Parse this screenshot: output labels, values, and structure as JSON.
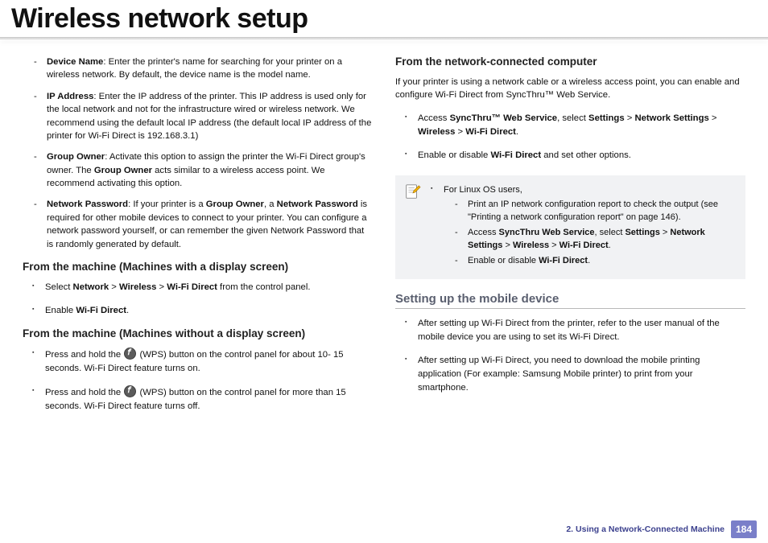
{
  "title": "Wireless network setup",
  "left": {
    "defs": [
      {
        "term": "Device Name",
        "body": ": Enter the printer's name for searching for your printer on a wireless network. By default, the device name is the model name."
      },
      {
        "term": "IP Address",
        "body": ": Enter the IP address of the printer. This IP address is used only for the local network and not for the infrastructure wired or wireless network. We recommend using the default local IP address (the default local IP address of the printer for Wi-Fi Direct is 192.168.3.1)"
      },
      {
        "term": "Group Owner",
        "body_pre": ": Activate this option to assign the printer the Wi-Fi Direct group's owner. The ",
        "body_bold": "Group Owner",
        "body_post": " acts similar to a wireless access point. We recommend activating this option."
      },
      {
        "term": "Network Password",
        "body_pre": ": If your printer is a ",
        "b1": "Group Owner",
        "mid": ", a ",
        "b2": "Network Password",
        "body_post": " is required for other mobile devices to connect to your printer. You can configure a network password yourself, or can remember the given Network Password that is randomly generated by default."
      }
    ],
    "h_display": "From the machine (Machines with a display screen)",
    "display_items": {
      "select_pre": "Select ",
      "p1": "Network",
      "p2": "Wireless",
      "p3": "Wi-Fi Direct",
      "select_post": " from the control panel.",
      "enable_pre": "Enable ",
      "enable_bold": "Wi-Fi Direct",
      "enable_post": "."
    },
    "h_nodisplay": "From the machine (Machines without a display screen)",
    "nodisplay": {
      "press_pre": "Press and hold the ",
      "wps_label": " (WPS) button on the control panel for about 10- 15 seconds. Wi-Fi Direct feature turns on.",
      "press2_post": " (WPS) button on the control panel for more than 15 seconds. Wi-Fi Direct feature turns off."
    }
  },
  "right": {
    "h_net": "From the network-connected computer",
    "net_intro": "If your printer is using a network cable or a wireless access point, you can enable and configure Wi-Fi Direct from SyncThru™ Web Service.",
    "net_items": {
      "access_pre": "Access ",
      "access_b": "SyncThru™ Web Service",
      "sel": ", select ",
      "s1": "Settings",
      "s2": "Network Settings",
      "s3": "Wireless",
      "s4": "Wi-Fi Direct",
      "enable_pre": "Enable or disable ",
      "enable_b": "Wi-Fi Direct",
      "enable_post": " and set other options."
    },
    "note": {
      "linux": "For Linux OS users,",
      "n1_pre": "Print an IP network configuration report to check the output (see \"Printing a network configuration report\" on page 146).",
      "n2_pre": "Access ",
      "n2_b": "SyncThru Web Service",
      "n2_sel": ", select ",
      "n2_s1": "Settings",
      "n2_s2": "Network Settings",
      "n2_s3": "Wireless",
      "n2_s4": "Wi-Fi Direct",
      "n3_pre": "Enable or disable ",
      "n3_b": "Wi-Fi Direct"
    },
    "h_mobile": "Setting up the mobile device",
    "mobile": {
      "m1": "After setting up Wi-Fi Direct from the printer, refer to the user manual of the mobile device you are using to set its Wi-Fi Direct.",
      "m2": "After setting up Wi-Fi Direct, you need to download the mobile printing application (For example: Samsung Mobile printer) to print from your smartphone."
    }
  },
  "footer": {
    "chapter": "2.  Using a Network-Connected Machine",
    "page": "184"
  }
}
